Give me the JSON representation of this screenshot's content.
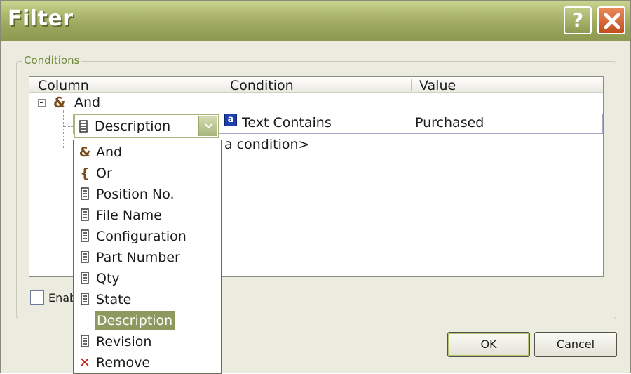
{
  "window": {
    "title": "Filter",
    "help_glyph": "?",
    "close_icon": "close-icon"
  },
  "conditions": {
    "group_label": "Conditions",
    "columns": [
      "Column",
      "Condition",
      "Value"
    ],
    "root": {
      "icon": "&",
      "label": "And"
    },
    "row": {
      "column_value": "Description",
      "condition_badge": "a",
      "condition": "Text Contains",
      "value": "Purchased"
    },
    "add_condition_text": "a condition>",
    "dropdown_items": [
      {
        "icon": "&",
        "icon_name": "and-icon",
        "label": "And"
      },
      {
        "icon": "{",
        "icon_name": "or-icon",
        "label": "Or"
      },
      {
        "icon": "column",
        "icon_name": "column-icon",
        "label": "Position No."
      },
      {
        "icon": "column",
        "icon_name": "column-icon",
        "label": "File Name"
      },
      {
        "icon": "column",
        "icon_name": "column-icon",
        "label": "Configuration"
      },
      {
        "icon": "column",
        "icon_name": "column-icon",
        "label": "Part Number"
      },
      {
        "icon": "column",
        "icon_name": "column-icon",
        "label": "Qty"
      },
      {
        "icon": "column",
        "icon_name": "column-icon",
        "label": "State"
      },
      {
        "icon": "",
        "icon_name": "",
        "label": "Description",
        "selected": true
      },
      {
        "icon": "column",
        "icon_name": "column-icon",
        "label": "Revision"
      },
      {
        "icon": "✕",
        "icon_name": "remove-icon",
        "label": "Remove"
      }
    ]
  },
  "footer": {
    "enable_label": "Enab",
    "ok": "OK",
    "cancel": "Cancel"
  },
  "colors": {
    "titlebar": "#98a45a",
    "selection": "#8d9a5f",
    "group_label": "#6e8a38",
    "condition_badge": "#1e3fae"
  }
}
